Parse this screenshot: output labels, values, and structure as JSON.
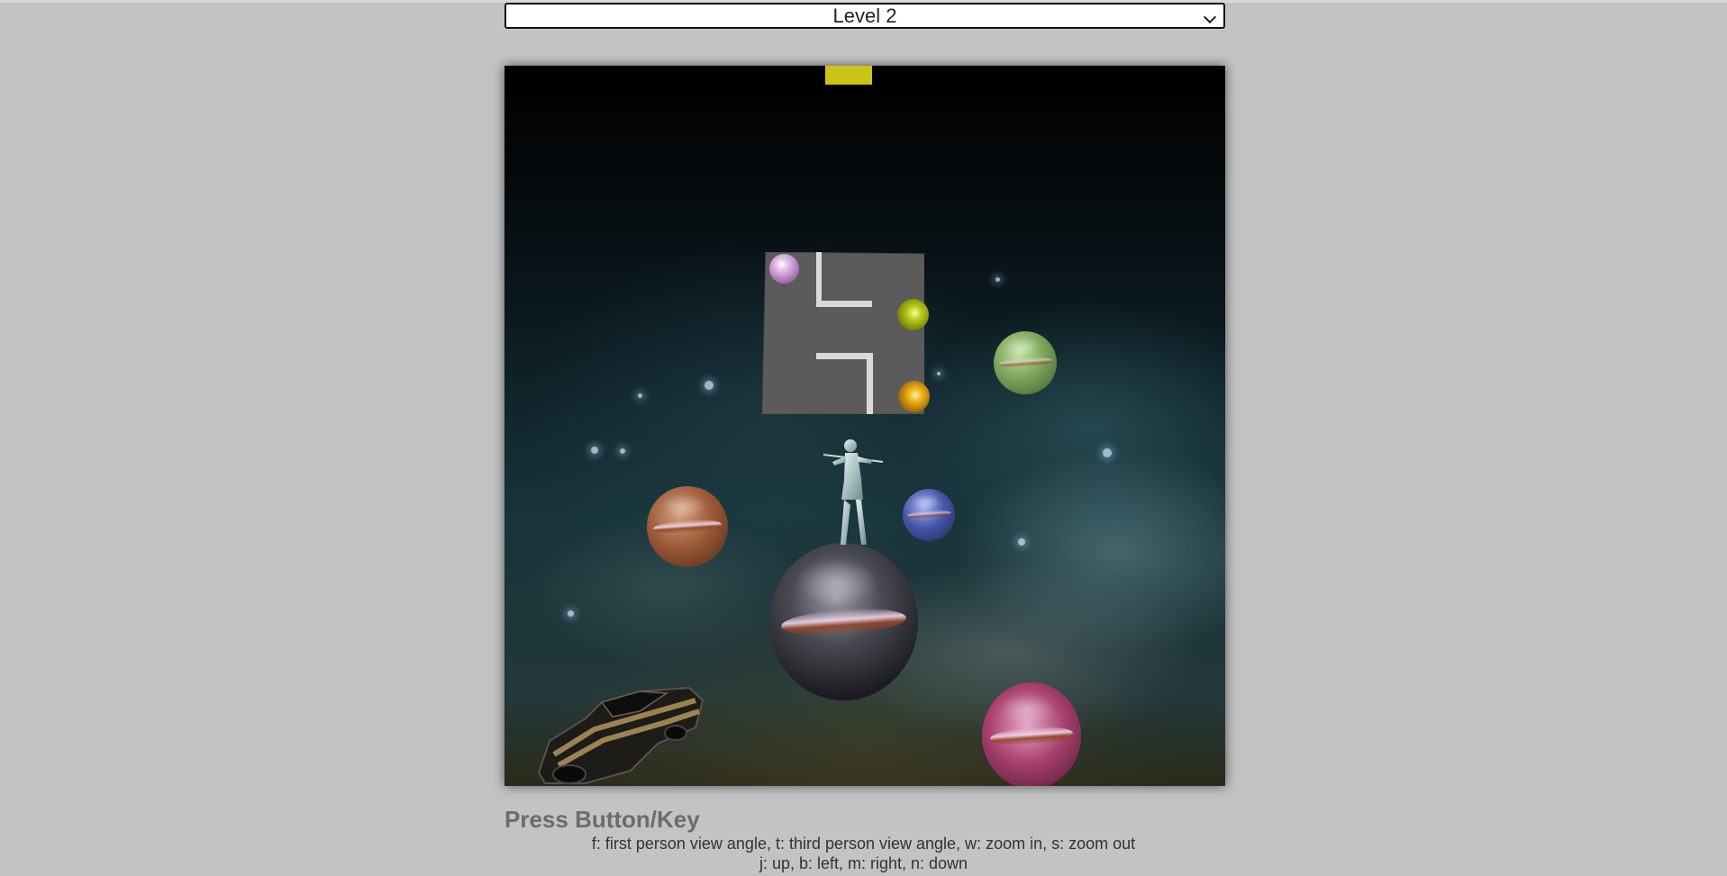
{
  "level_select": {
    "selected": "Level 2",
    "icon": "chevron-down-icon"
  },
  "scene": {
    "objects": [
      "yellow-marker",
      "maze-board",
      "pink-ball",
      "yellow-green-ball",
      "gold-ball",
      "green-planet",
      "brown-planet",
      "blue-planet",
      "dark-planet",
      "magenta-planet",
      "player-figure",
      "car-model"
    ],
    "colors": {
      "background": "#c3c3c3",
      "board": "#5a5a5a",
      "maze_walls": "#d7d7d7",
      "marker": "#c9c416"
    }
  },
  "instructions": {
    "title": "Press Button/Key",
    "line1": "f: first person view angle, t: third person view angle, w: zoom in, s: zoom out",
    "line2": "j: up, b: left, m: right, n: down"
  }
}
